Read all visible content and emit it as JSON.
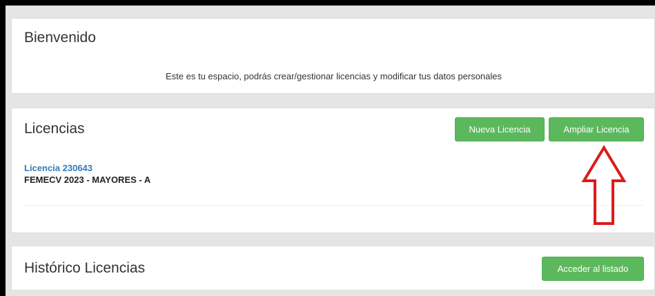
{
  "welcome": {
    "title": "Bienvenido",
    "message": "Este es tu espacio, podrás crear/gestionar licencias y modificar tus datos personales"
  },
  "licencias": {
    "title": "Licencias",
    "new_button": "Nueva Licencia",
    "extend_button": "Ampliar Licencia",
    "items": [
      {
        "link": "Licencia 230643",
        "description": "FEMECV 2023 - MAYORES - A"
      }
    ]
  },
  "historico": {
    "title": "Histórico Licencias",
    "list_button": "Acceder al listado"
  },
  "colors": {
    "button_green": "#5cb85c",
    "link_blue": "#337ab7",
    "annotation_red": "#dd1a1a"
  },
  "annotation": {
    "icon": "up-arrow-icon"
  }
}
